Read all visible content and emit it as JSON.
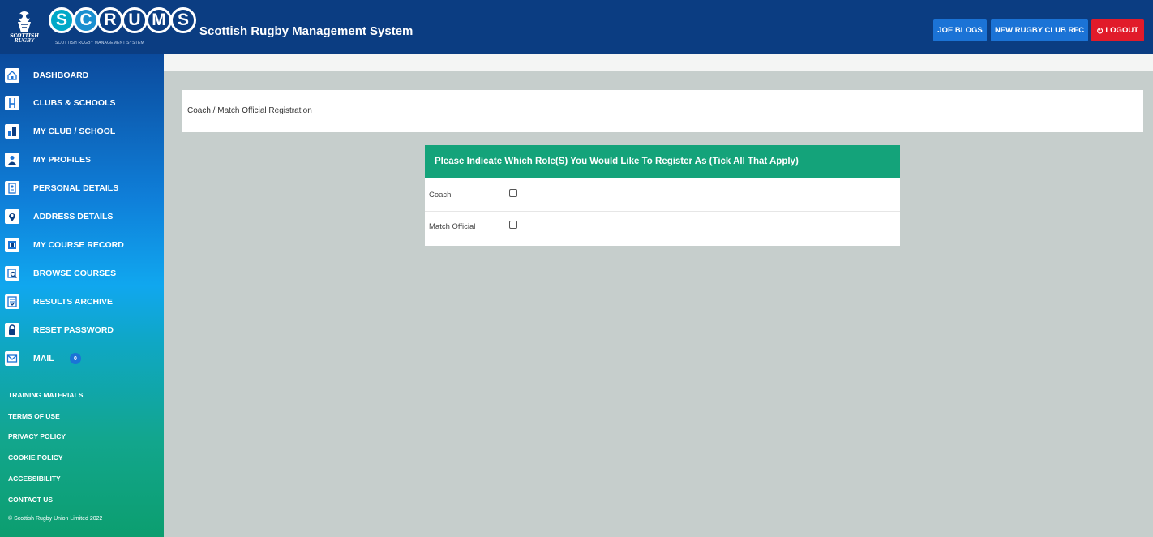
{
  "header": {
    "app_title": "Scottish Rugby Management System",
    "logo": {
      "emblem_text": "SCOTTISH RUGBY",
      "letters": [
        "S",
        "C",
        "R",
        "U",
        "M",
        "S"
      ],
      "subtitle": "SCOTTISH RUGBY MANAGEMENT SYSTEM"
    },
    "user_button": "JOE BLOGS",
    "club_button": "NEW RUGBY CLUB RFC",
    "logout_button": "LOGOUT"
  },
  "sidebar": {
    "items": [
      {
        "label": "DASHBOARD",
        "icon": "dashboard-icon"
      },
      {
        "label": "CLUBS & SCHOOLS",
        "icon": "goalposts-icon"
      },
      {
        "label": "MY CLUB / SCHOOL",
        "icon": "club-icon"
      },
      {
        "label": "MY PROFILES",
        "icon": "profiles-icon"
      },
      {
        "label": "PERSONAL DETAILS",
        "icon": "personal-details-icon"
      },
      {
        "label": "ADDRESS DETAILS",
        "icon": "location-pin-icon"
      },
      {
        "label": "MY COURSE RECORD",
        "icon": "course-record-icon"
      },
      {
        "label": "BROWSE COURSES",
        "icon": "browse-courses-icon"
      },
      {
        "label": "RESULTS ARCHIVE",
        "icon": "results-archive-icon"
      },
      {
        "label": "RESET PASSWORD",
        "icon": "lock-icon"
      },
      {
        "label": "MAIL",
        "icon": "mail-icon",
        "badge": "0"
      }
    ],
    "footer_links": [
      "TRAINING MATERIALS",
      "TERMS OF USE",
      "PRIVACY POLICY",
      "COOKIE POLICY",
      "ACCESSIBILITY",
      "CONTACT US"
    ],
    "copyright": "© Scottish Rugby Union Limited 2022"
  },
  "main": {
    "breadcrumb": "Coach / Match Official Registration",
    "panel": {
      "title": "Please Indicate Which Role(S) You Would Like To Register As (Tick All That Apply)",
      "roles": [
        {
          "label": "Coach",
          "checked": false
        },
        {
          "label": "Match Official",
          "checked": false
        }
      ]
    }
  },
  "colors": {
    "header_bg": "#0b3d82",
    "button_blue": "#1b73d6",
    "logout_red": "#e11b2a",
    "panel_green": "#14a37a",
    "page_bg": "#c6cecc"
  }
}
